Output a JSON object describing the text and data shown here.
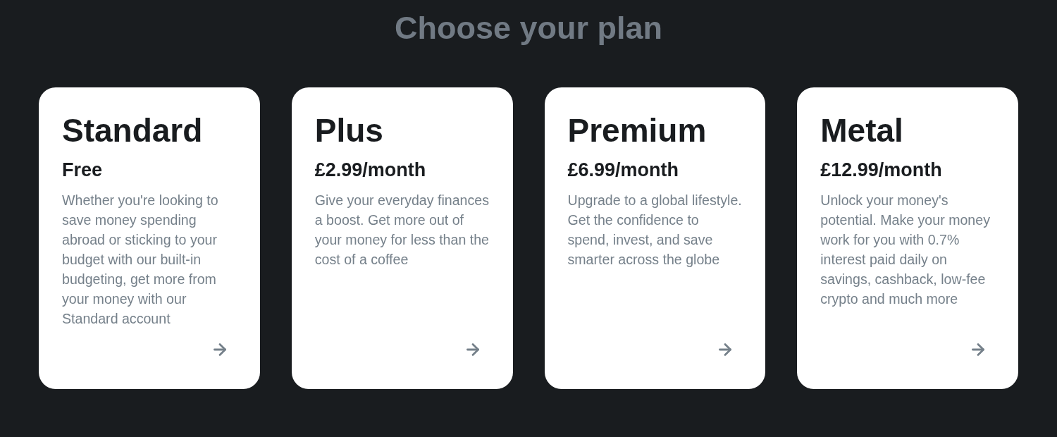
{
  "page": {
    "title": "Choose your plan"
  },
  "plans": [
    {
      "name": "Standard",
      "price": "Free",
      "description": "Whether you're looking to save money spending abroad or sticking to your budget with our built-in budgeting, get more from your money with our Standard account"
    },
    {
      "name": "Plus",
      "price": "£2.99/month",
      "description": "Give your everyday finances a boost. Get more out of your money for less than the cost of a coffee"
    },
    {
      "name": "Premium",
      "price": "£6.99/month",
      "description": "Upgrade to a global lifestyle. Get the confidence to spend, invest, and save smarter across the globe"
    },
    {
      "name": "Metal",
      "price": "£12.99/month",
      "description": "Unlock your money's potential. Make your money work for you with 0.7% interest paid daily on savings, cashback, low-fee crypto and much more"
    }
  ]
}
